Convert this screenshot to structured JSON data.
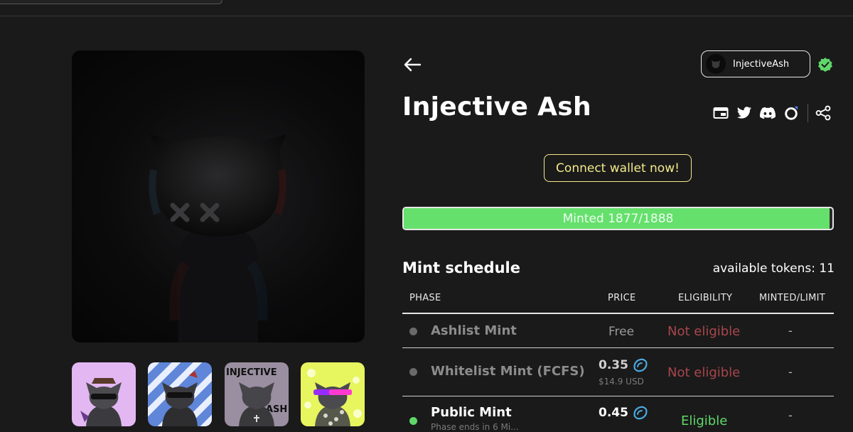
{
  "collection": {
    "title": "Injective Ash",
    "creator": "InjectiveAsh"
  },
  "actions": {
    "connect_label": "Connect wallet now!"
  },
  "progress": {
    "label": "Minted 1877/1888",
    "minted": 1877,
    "total": 1888
  },
  "schedule": {
    "title": "Mint schedule",
    "available": "available tokens: 11",
    "headers": {
      "phase": "PHASE",
      "price": "PRICE",
      "eligibility": "ELIGIBILITY",
      "limit": "MINTED/LIMIT"
    },
    "rows": [
      {
        "name": "Ashlist Mint",
        "price": "Free",
        "eligibility": "Not eligible",
        "limit": "-"
      },
      {
        "name": "Whitelist Mint (FCFS)",
        "price": "0.35",
        "usd": "$14.9 USD",
        "eligibility": "Not eligible",
        "limit": "-"
      },
      {
        "name": "Public Mint",
        "sub": "Phase ends in 6 Mi...",
        "price": "0.45",
        "eligibility": "Eligible",
        "limit": "-"
      }
    ]
  },
  "icons": {
    "back": "arrow-left-icon",
    "verified": "verified-badge-icon",
    "socials": [
      "website-icon",
      "twitter-icon",
      "discord-icon",
      "marketplace-icon",
      "share-icon"
    ],
    "token": "injective-token-icon"
  },
  "colors": {
    "progress": "#66e06c",
    "connect": "#f3ea8c",
    "not_eligible": "#a8464c",
    "eligible": "#5fd86a",
    "verified": "#5fd86a"
  }
}
